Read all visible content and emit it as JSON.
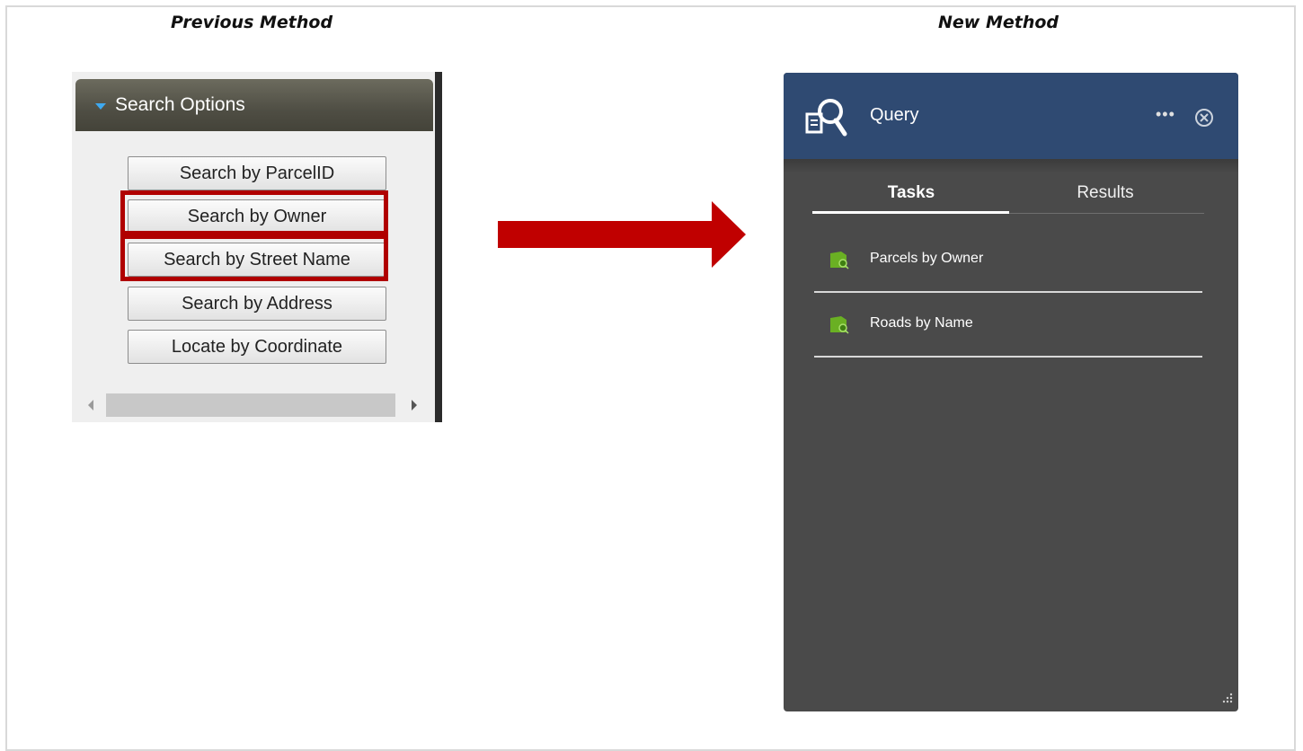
{
  "headings": {
    "previous": "Previous Method",
    "new": "New Method"
  },
  "old_panel": {
    "header_title": "Search Options",
    "buttons": [
      {
        "label": "Search by ParcelID",
        "highlighted": false
      },
      {
        "label": "Search by Owner",
        "highlighted": true
      },
      {
        "label": "Search by Street Name",
        "highlighted": true
      },
      {
        "label": "Search by Address",
        "highlighted": false
      },
      {
        "label": "Locate by Coordinate",
        "highlighted": false
      }
    ]
  },
  "new_panel": {
    "title": "Query",
    "more_icon": "ellipsis-icon",
    "close_icon": "close-circle-icon",
    "tabs": [
      {
        "label": "Tasks",
        "active": true
      },
      {
        "label": "Results",
        "active": false
      }
    ],
    "tasks": [
      {
        "label": "Parcels by Owner",
        "icon": "layer-search-icon"
      },
      {
        "label": "Roads by Name",
        "icon": "layer-search-icon"
      }
    ]
  },
  "colors": {
    "highlight_red": "#b00000",
    "query_header": "#2f4a72",
    "panel_body": "#4a4a4a",
    "task_icon_green": "#6ab023"
  }
}
